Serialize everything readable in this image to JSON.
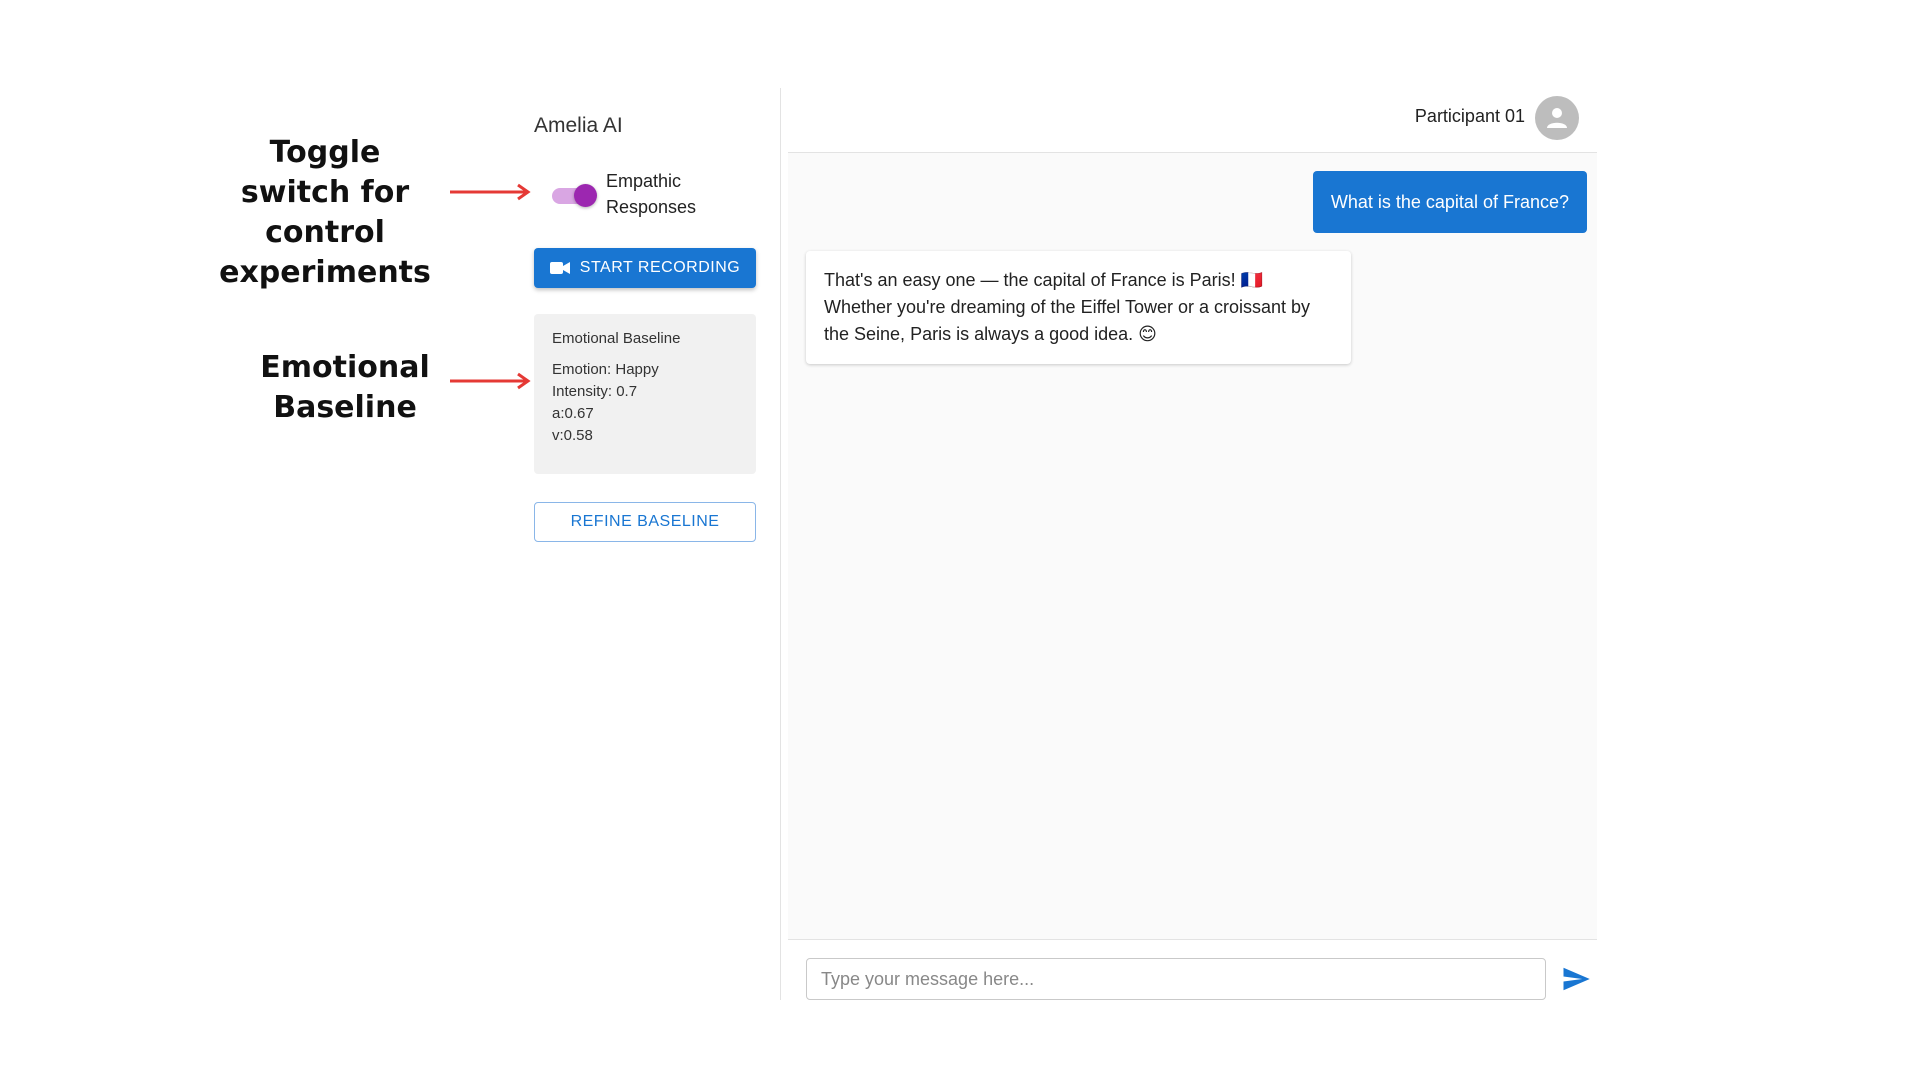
{
  "annotations": {
    "toggle": "Toggle switch for control experiments",
    "baseline": "Emotional Baseline"
  },
  "sidebar": {
    "app_title": "Amelia AI",
    "toggle": {
      "label": "Empathic Responses",
      "on": true,
      "color": "#9c27b0"
    },
    "record_button": {
      "label": "START RECORDING",
      "icon": "videocam-icon"
    },
    "baseline": {
      "title": "Emotional Baseline",
      "emotion": "Emotion: Happy",
      "intensity": "Intensity: 0.7",
      "arousal": "a:0.67",
      "valence": "v:0.58"
    },
    "refine_button": {
      "label": "REFINE BASELINE"
    }
  },
  "header": {
    "participant": "Participant 01",
    "avatar_icon": "person-icon"
  },
  "messages": [
    {
      "role": "user",
      "text": "What is the capital of France?"
    },
    {
      "role": "assistant",
      "text": "That's an easy one — the capital of France is Paris! 🇫🇷 Whether you're dreaming of the Eiffel Tower or a croissant by the Seine, Paris is always a good idea. 😊"
    }
  ],
  "composer": {
    "placeholder": "Type your message here...",
    "value": "",
    "send_icon": "send-icon"
  },
  "colors": {
    "primary": "#1976d2",
    "toggle_accent": "#9c27b0",
    "annotation_arrow": "#e53935"
  }
}
